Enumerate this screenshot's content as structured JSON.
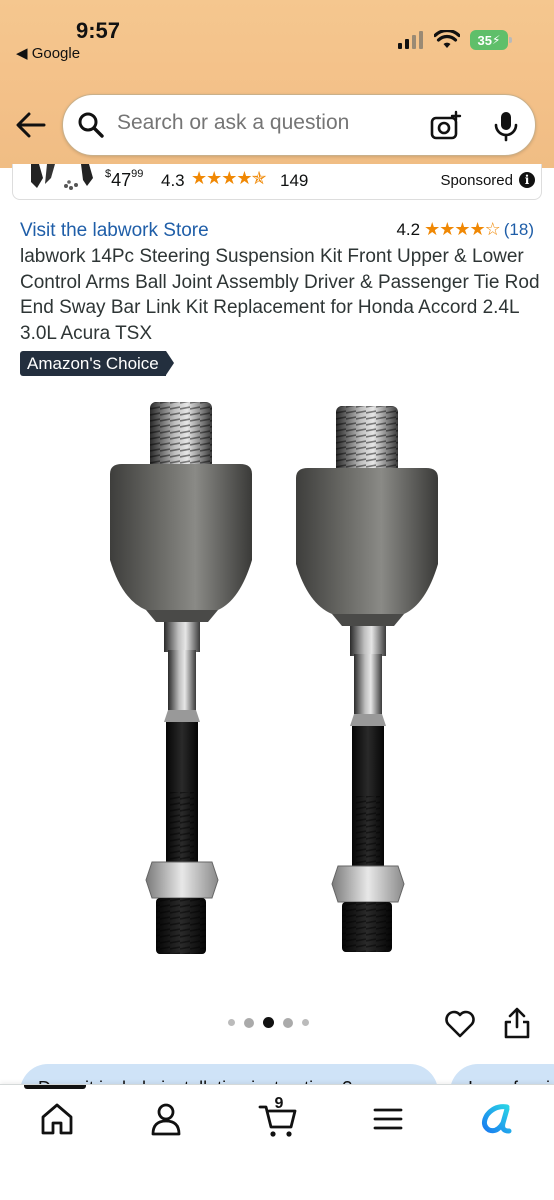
{
  "status_bar": {
    "time": "9:57",
    "back_app": "◀ Google",
    "battery": "35"
  },
  "search": {
    "placeholder": "Search or ask a question"
  },
  "sponsored_ad": {
    "price_symbol": "$",
    "price_whole": "47",
    "price_fraction": "99",
    "rating": "4.3",
    "stars": "★★★★✯",
    "review_count": "149",
    "label": "Sponsored",
    "info_glyph": "i"
  },
  "product": {
    "store_link": "Visit the labwork Store",
    "rating": "4.2",
    "stars": "★★★★☆",
    "review_count": "(18)",
    "title": "labwork 14Pc Steering Suspension Kit Front Upper & Lower Control Arms Ball Joint Assembly Driver & Passenger Tie Rod End Sway Bar Link Kit Replacement for Honda Accord 2.4L 3.0L Acura TSX",
    "badge": "Amazon's Choice"
  },
  "carousel": {
    "image_count": 5,
    "active_index": 2
  },
  "questions": [
    "Does it include installation instructions?",
    "Is professi"
  ],
  "bottom_nav": {
    "cart_count": "9",
    "items": [
      "home-icon",
      "account-icon",
      "cart-icon",
      "menu-icon",
      "rufus-icon"
    ]
  },
  "colors": {
    "header_bg": "#f3c088",
    "link": "#1f5ea8",
    "star": "#f08804",
    "badge_bg": "#232f3e",
    "chip_bg": "#cfe3f7"
  }
}
